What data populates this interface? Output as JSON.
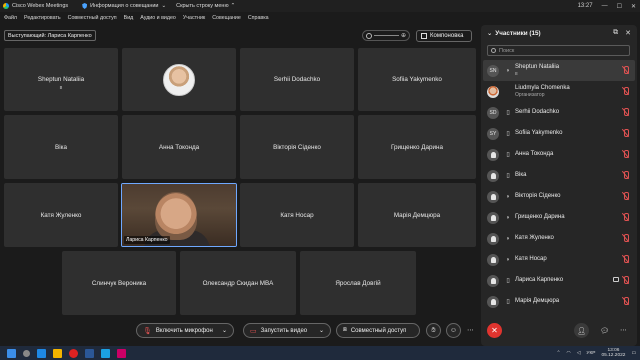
{
  "titlebar": {
    "app_name": "Cisco Webex Meetings",
    "meeting_info": "Информация о совещании",
    "hide_menu": "Скрыть строку меню",
    "time": "13:27"
  },
  "menu": [
    "Файл",
    "Редактировать",
    "Совместный доступ",
    "Вид",
    "Аудио и видео",
    "Участник",
    "Совещание",
    "Справка"
  ],
  "stage": {
    "presenter_label": "Выступающий: Лариса Карпенко",
    "layout_button": "Компоновка"
  },
  "tiles": [
    {
      "name": "Sheptun Nataliia",
      "sub": "в"
    },
    {
      "name": "",
      "photo": true
    },
    {
      "name": "Serhii Dodachko"
    },
    {
      "name": "Sofiia Yakymenko"
    },
    {
      "name": "Віка"
    },
    {
      "name": "Анна Токонда"
    },
    {
      "name": "Вікторія Сіденко"
    },
    {
      "name": "Грищенко Дарина"
    },
    {
      "name": "Катя Жуленко"
    },
    {
      "name": "Лариса Карпенко",
      "video": true
    },
    {
      "name": "Катя Носар"
    },
    {
      "name": "Марія Демцюра"
    },
    {
      "name": "Слинчук Вероника"
    },
    {
      "name": "Олександр Скидан MBA"
    },
    {
      "name": "Ярослав Довгій"
    }
  ],
  "participants_panel": {
    "title": "Участники (15)",
    "search_placeholder": "Поиск",
    "items": [
      {
        "initials": "SN",
        "device": "audio",
        "name": "Sheptun Nataliia",
        "role": "в",
        "muted": true
      },
      {
        "initials": "",
        "photo": true,
        "device": "",
        "name": "Liudmyla Chomenka",
        "role": "Организатор",
        "muted": true
      },
      {
        "initials": "SD",
        "device": "phone",
        "name": "Serhii Dodachko",
        "role": "",
        "muted": true
      },
      {
        "initials": "SY",
        "device": "phone",
        "name": "Sofiia Yakymenko",
        "role": "",
        "muted": true
      },
      {
        "initials": "",
        "device": "phone",
        "name": "Анна Токонда",
        "role": "",
        "muted": true
      },
      {
        "initials": "",
        "device": "phone",
        "name": "Віка",
        "role": "",
        "muted": true
      },
      {
        "initials": "",
        "device": "audio",
        "name": "Вікторія Сіденко",
        "role": "",
        "muted": true
      },
      {
        "initials": "",
        "device": "audio",
        "name": "Грищенко Дарина",
        "role": "",
        "muted": true
      },
      {
        "initials": "",
        "device": "audio",
        "name": "Катя Жуленко",
        "role": "",
        "muted": true
      },
      {
        "initials": "",
        "device": "audio",
        "name": "Катя Носар",
        "role": "",
        "muted": true
      },
      {
        "initials": "",
        "device": "phone",
        "name": "Лариса Карпенко",
        "role": "",
        "muted": true,
        "video": true
      },
      {
        "initials": "",
        "device": "phone",
        "name": "Марія Демцюра",
        "role": "",
        "muted": true
      }
    ]
  },
  "controls": {
    "mute": "Включить микрофон",
    "video": "Запустить видео",
    "share": "Совместный доступ"
  },
  "taskbar": {
    "lang": "УКР",
    "time": "13:06",
    "date": "05.12.2022"
  }
}
